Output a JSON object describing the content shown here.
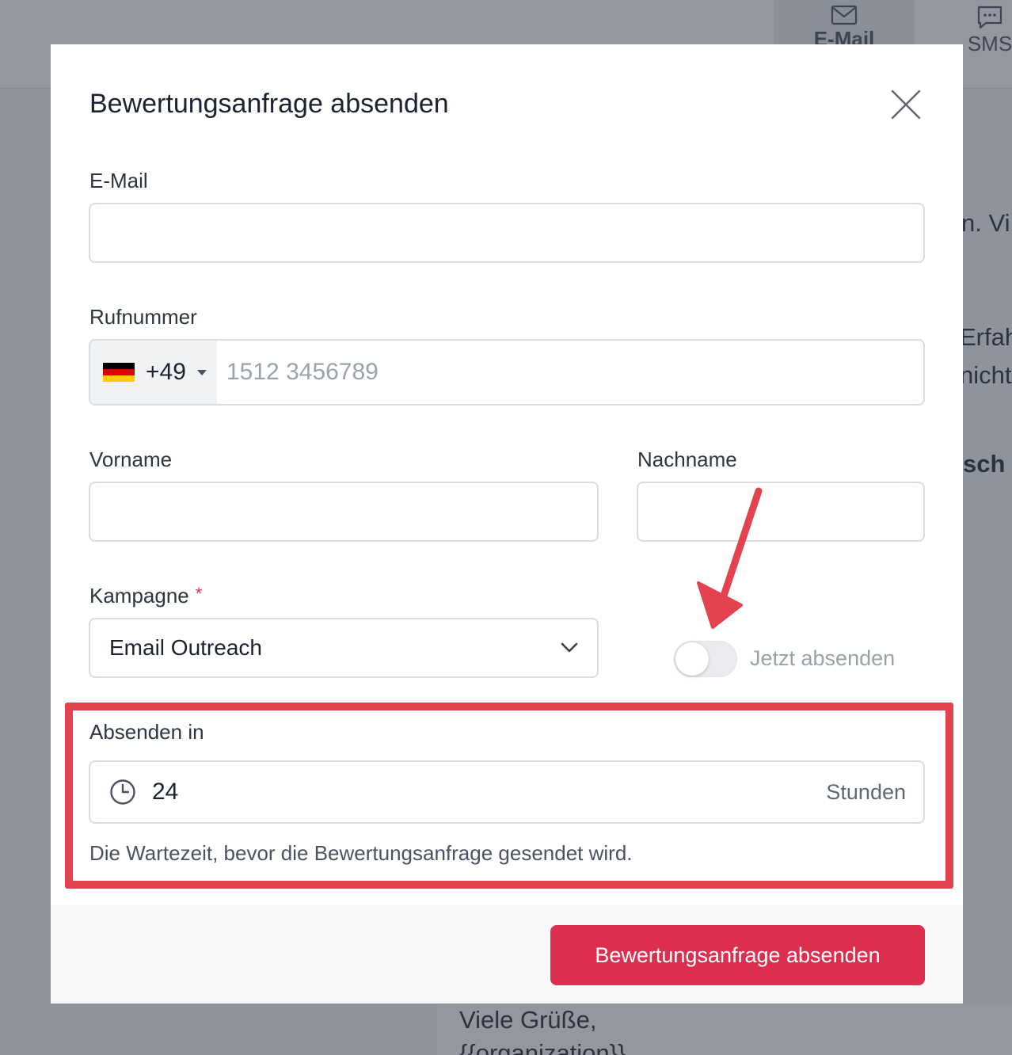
{
  "background": {
    "tabs": [
      {
        "label": "E-Mail",
        "icon": "envelope-icon"
      },
      {
        "label": "SMS",
        "icon": "chat-icon"
      }
    ],
    "fragments": [
      "n. Vi",
      "Erfah",
      "nicht",
      "sch"
    ],
    "bottom_lines": [
      "Viele Grüße,",
      "{{organization}}"
    ]
  },
  "modal": {
    "title": "Bewertungsanfrage absenden",
    "email": {
      "label": "E-Mail",
      "value": ""
    },
    "phone": {
      "label": "Rufnummer",
      "country_code": "+49",
      "country": "Germany",
      "placeholder": "1512 3456789",
      "value": ""
    },
    "first_name": {
      "label": "Vorname",
      "value": ""
    },
    "last_name": {
      "label": "Nachname",
      "value": ""
    },
    "campaign": {
      "label": "Kampagne",
      "required_marker": "*",
      "selected": "Email Outreach"
    },
    "send_now": {
      "label": "Jetzt absenden",
      "checked": false
    },
    "delay": {
      "label": "Absenden in",
      "value": "24",
      "unit": "Stunden",
      "hint": "Die Wartezeit, bevor die Bewertungsanfrage gesendet wird."
    },
    "submit_label": "Bewertungsanfrage absenden"
  },
  "colors": {
    "accent": "#dc2f4f",
    "annotation": "#e3424f",
    "flag": [
      "#000000",
      "#dd0000",
      "#ffcc00"
    ]
  }
}
